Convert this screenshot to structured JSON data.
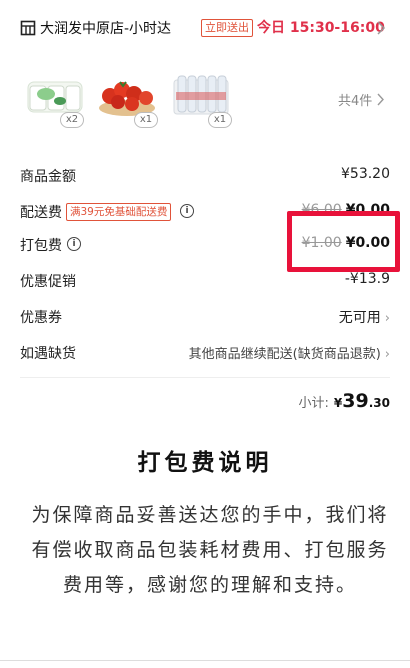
{
  "store": {
    "name": "大润发中原店-小时达",
    "badge": "立即送出",
    "delivery_time": "今日 15:30-16:00"
  },
  "products": [
    {
      "name": "yogurt-pack",
      "qty": "x2"
    },
    {
      "name": "cherry-tomatoes",
      "qty": "x1"
    },
    {
      "name": "bottled-water",
      "qty": "x1"
    }
  ],
  "products_total": "共4件",
  "fees": {
    "goods_amount": {
      "label": "商品金额",
      "value": "¥53.20"
    },
    "delivery": {
      "label": "配送费",
      "promo": "满39元免基础配送费",
      "original": "¥6.00",
      "value": "¥0.00"
    },
    "packing": {
      "label": "打包费",
      "original": "¥1.00",
      "value": "¥0.00"
    },
    "discount": {
      "label": "优惠促销",
      "value": "-¥13.9"
    },
    "coupon": {
      "label": "优惠券",
      "value": "无可用"
    },
    "out_of_stock": {
      "label": "如遇缺货",
      "value": "其他商品继续配送(缺货商品退款)"
    }
  },
  "subtotal": {
    "label": "小计:",
    "currency": "¥",
    "integer": "39",
    "decimal": ".30"
  },
  "note": {
    "title": "打包费说明",
    "body": "为保障商品妥善送达您的手中，我们将有偿收取商品包装耗材费用、打包服务费用等，感谢您的理解和支持。"
  },
  "colors": {
    "accent": "#e0304a",
    "highlight": "#e8123a"
  }
}
